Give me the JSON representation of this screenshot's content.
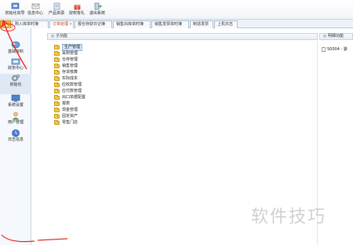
{
  "toolbar": {
    "buttons": [
      {
        "label": "初始化向导",
        "icon": "wizard-icon"
      },
      {
        "label": "信息中心",
        "icon": "info-center-icon"
      },
      {
        "label": "产品资源",
        "icon": "product-resource-icon"
      },
      {
        "label": "授权有礼",
        "icon": "gift-icon"
      },
      {
        "label": "退出系统",
        "icon": "exit-icon"
      }
    ]
  },
  "tabs": [
    {
      "label": "购入库单时簿"
    },
    {
      "label": "订单处理",
      "active": true
    },
    {
      "label": "报仓存获日记簿"
    },
    {
      "label": "销售出库单时簿"
    },
    {
      "label": "销售发票单时簿"
    },
    {
      "label": "制造发票"
    },
    {
      "label": "上机日志"
    }
  ],
  "leftnav": {
    "items": [
      {
        "label": "基础资料",
        "icon": "base-data-icon"
      },
      {
        "label": "财务中心",
        "icon": "finance-icon"
      },
      {
        "label": "初始化",
        "icon": "init-icon"
      },
      {
        "label": "系统设置",
        "icon": "system-settings-icon"
      },
      {
        "label": "用户管理",
        "icon": "user-management-icon"
      },
      {
        "label": "日志信息",
        "icon": "log-info-icon"
      }
    ]
  },
  "main_panel": {
    "title": "子功能",
    "items": [
      {
        "label": "生产管理",
        "selected": true
      },
      {
        "label": "采购管理"
      },
      {
        "label": "仓存管理"
      },
      {
        "label": "销售管理"
      },
      {
        "label": "存货核算"
      },
      {
        "label": "实际成本"
      },
      {
        "label": "应收款管理"
      },
      {
        "label": "应付款管理"
      },
      {
        "label": "出口单据配置"
      },
      {
        "label": "报表"
      },
      {
        "label": "现金管理"
      },
      {
        "label": "固定资产"
      },
      {
        "label": "零售门店"
      }
    ]
  },
  "right_panel": {
    "title": "明细功能",
    "item": "S0004 - 委"
  },
  "watermark": "软件技巧",
  "colors": {
    "accent": "#c04000",
    "annotation": "#e8281e",
    "folder": "#f3c948"
  }
}
